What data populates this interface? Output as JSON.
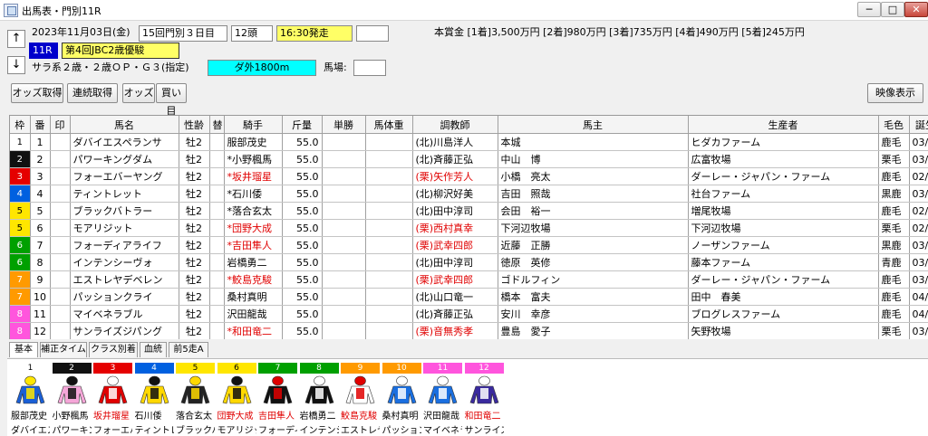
{
  "window": {
    "title": "出馬表・門別11R",
    "min": "─",
    "max": "□",
    "close": "✕"
  },
  "nav": {
    "up": "↑",
    "down": "↓"
  },
  "race": {
    "date": "2023年11月03日(金)",
    "meeting": "15回門別３日目",
    "heads": "12頭",
    "start": "16:30発走",
    "number": "11R",
    "name": "第4回JBC2歳優駿",
    "condition": "サラ系２歳・２歳ＯＰ・Ｇ３(指定)",
    "course": "ダ外1800m",
    "going_label": "馬場:",
    "prize": "本賞金 [1着]3,500万円 [2着]980万円 [3着]735万円 [4着]490万円 [5着]245万円"
  },
  "toolbar": {
    "odds_fetch": "オッズ取得",
    "auto_fetch": "連続取得",
    "odds": "オッズ",
    "buy": "買い目",
    "video": "映像表示"
  },
  "colors": {
    "waku": [
      "#ffffff",
      "#111111",
      "#e50000",
      "#0060e0",
      "#ffe600",
      "#ffe600",
      "#00a000",
      "#00a000",
      "#ff9a00",
      "#ff9a00",
      "#ff55dd",
      "#ff55dd"
    ],
    "waku_text": [
      "#000",
      "#fff",
      "#fff",
      "#fff",
      "#000",
      "#000",
      "#fff",
      "#fff",
      "#fff",
      "#fff",
      "#fff",
      "#fff"
    ],
    "start_bg": "#ffff66",
    "course_bg": "#00ffff",
    "race_no_bg": "#0000cc"
  },
  "table": {
    "headers": [
      "枠",
      "番",
      "印",
      "馬名",
      "性齢",
      "替",
      "騎手",
      "斤量",
      "単勝",
      "馬体重",
      "調教師",
      "馬主",
      "生産者",
      "毛色",
      "誕生"
    ],
    "rows": [
      {
        "waku": "1",
        "ban": "1",
        "mark": "",
        "name": "ダバイエスペランサ",
        "sex": "牡2",
        "change": "",
        "jockey": "服部茂史",
        "kin": "55.0",
        "tan": "",
        "weight": "",
        "trainer": "(北)川島洋人",
        "owner": "本城",
        "breeder": "ヒダカファーム",
        "color": "鹿毛",
        "birth": "03/22",
        "red": false
      },
      {
        "waku": "2",
        "ban": "2",
        "mark": "",
        "name": "パワーキングダム",
        "sex": "牡2",
        "change": "",
        "jockey": "*小野楓馬",
        "kin": "55.0",
        "tan": "",
        "weight": "",
        "trainer": "(北)斉藤正弘",
        "owner": "中山　博",
        "breeder": "広富牧場",
        "color": "栗毛",
        "birth": "03/05",
        "red": false
      },
      {
        "waku": "3",
        "ban": "3",
        "mark": "",
        "name": "フォーエバーヤング",
        "sex": "牡2",
        "change": "",
        "jockey": "*坂井瑠星",
        "kin": "55.0",
        "tan": "",
        "weight": "",
        "trainer": "(栗)矢作芳人",
        "owner": "小橋　亮太",
        "breeder": "ダーレー・ジャパン・ファーム",
        "color": "鹿毛",
        "birth": "02/15",
        "red": true
      },
      {
        "waku": "4",
        "ban": "4",
        "mark": "",
        "name": "ティントレット",
        "sex": "牡2",
        "change": "",
        "jockey": "*石川倭",
        "kin": "55.0",
        "tan": "",
        "weight": "",
        "trainer": "(北)柳沢好美",
        "owner": "吉田　照哉",
        "breeder": "社台ファーム",
        "color": "黒鹿",
        "birth": "03/28",
        "red": false
      },
      {
        "waku": "5",
        "ban": "5",
        "mark": "",
        "name": "ブラックバトラー",
        "sex": "牡2",
        "change": "",
        "jockey": "*落合玄太",
        "kin": "55.0",
        "tan": "",
        "weight": "",
        "trainer": "(北)田中淳司",
        "owner": "会田　裕一",
        "breeder": "増尾牧場",
        "color": "鹿毛",
        "birth": "02/25",
        "red": false
      },
      {
        "waku": "5",
        "ban": "6",
        "mark": "",
        "name": "モアリジット",
        "sex": "牡2",
        "change": "",
        "jockey": "*団野大成",
        "kin": "55.0",
        "tan": "",
        "weight": "",
        "trainer": "(栗)西村真幸",
        "owner": "下河辺牧場",
        "breeder": "下河辺牧場",
        "color": "栗毛",
        "birth": "02/10",
        "red": true
      },
      {
        "waku": "6",
        "ban": "7",
        "mark": "",
        "name": "フォーディアライフ",
        "sex": "牡2",
        "change": "",
        "jockey": "*吉田隼人",
        "kin": "55.0",
        "tan": "",
        "weight": "",
        "trainer": "(栗)武幸四郎",
        "owner": "近藤　正勝",
        "breeder": "ノーザンファーム",
        "color": "黒鹿",
        "birth": "03/01",
        "red": true
      },
      {
        "waku": "6",
        "ban": "8",
        "mark": "",
        "name": "インテンシーヴォ",
        "sex": "牡2",
        "change": "",
        "jockey": "岩橋勇二",
        "kin": "55.0",
        "tan": "",
        "weight": "",
        "trainer": "(北)田中淳司",
        "owner": "徳原　英修",
        "breeder": "藤本ファーム",
        "color": "青鹿",
        "birth": "03/20",
        "red": false
      },
      {
        "waku": "7",
        "ban": "9",
        "mark": "",
        "name": "エストレヤデベレン",
        "sex": "牡2",
        "change": "",
        "jockey": "*鮫島克駿",
        "kin": "55.0",
        "tan": "",
        "weight": "",
        "trainer": "(栗)武幸四郎",
        "owner": "ゴドルフィン",
        "breeder": "ダーレー・ジャパン・ファーム",
        "color": "鹿毛",
        "birth": "03/19",
        "red": true
      },
      {
        "waku": "7",
        "ban": "10",
        "mark": "",
        "name": "パッションクライ",
        "sex": "牡2",
        "change": "",
        "jockey": "桑村真明",
        "kin": "55.0",
        "tan": "",
        "weight": "",
        "trainer": "(北)山口竜一",
        "owner": "橋本　富夫",
        "breeder": "田中　春美",
        "color": "鹿毛",
        "birth": "04/30",
        "red": false
      },
      {
        "waku": "8",
        "ban": "11",
        "mark": "",
        "name": "マイベネラブル",
        "sex": "牡2",
        "change": "",
        "jockey": "沢田龍哉",
        "kin": "55.0",
        "tan": "",
        "weight": "",
        "trainer": "(北)斉藤正弘",
        "owner": "安川　幸彦",
        "breeder": "ブログレスファーム",
        "color": "鹿毛",
        "birth": "04/08",
        "red": false
      },
      {
        "waku": "8",
        "ban": "12",
        "mark": "",
        "name": "サンライズジパング",
        "sex": "牡2",
        "change": "",
        "jockey": "*和田竜二",
        "kin": "55.0",
        "tan": "",
        "weight": "",
        "trainer": "(栗)音無秀孝",
        "owner": "豊島　愛子",
        "breeder": "矢野牧場",
        "color": "栗毛",
        "birth": "03/13",
        "red": true
      }
    ]
  },
  "tabs": [
    "基本",
    "補正タイム",
    "クラス別着",
    "血統",
    "前5走A"
  ],
  "silks": [
    {
      "num": "1",
      "jockey": "服部茂史",
      "horse": "ダバイエスペ",
      "red": false,
      "body": "#1a5fd6",
      "pat": "#ffe600"
    },
    {
      "num": "2",
      "jockey": "小野楓馬",
      "horse": "パワーキング",
      "red": false,
      "body": "#f5a6d8",
      "pat": "#111111"
    },
    {
      "num": "3",
      "jockey": "坂井瑠星",
      "horse": "フォーエバー",
      "red": true,
      "body": "#e00000",
      "pat": "#ffffff"
    },
    {
      "num": "4",
      "jockey": "石川倭",
      "horse": "ティントレッ",
      "red": false,
      "body": "#ffd800",
      "pat": "#111111"
    },
    {
      "num": "5",
      "jockey": "落合玄太",
      "horse": "ブラックバト",
      "red": false,
      "body": "#222222",
      "pat": "#ffd800"
    },
    {
      "num": "6",
      "jockey": "団野大成",
      "horse": "モアリジット",
      "red": true,
      "body": "#ffd800",
      "pat": "#111111"
    },
    {
      "num": "7",
      "jockey": "吉田隼人",
      "horse": "フォーディア",
      "red": true,
      "body": "#111111",
      "pat": "#e00000"
    },
    {
      "num": "8",
      "jockey": "岩橋勇二",
      "horse": "インテンシー",
      "red": false,
      "body": "#111111",
      "pat": "#ffffff"
    },
    {
      "num": "9",
      "jockey": "鮫島克駿",
      "horse": "エストレヤデ",
      "red": true,
      "body": "#ffffff",
      "pat": "#e00000"
    },
    {
      "num": "10",
      "jockey": "桑村真明",
      "horse": "パッションク",
      "red": false,
      "body": "#1a6fe0",
      "pat": "#ffffff"
    },
    {
      "num": "11",
      "jockey": "沢田龍哉",
      "horse": "マイベネラブ",
      "red": false,
      "body": "#1a6fe0",
      "pat": "#ffffff"
    },
    {
      "num": "12",
      "jockey": "和田竜二",
      "horse": "サンライズジ",
      "red": true,
      "body": "#3a2a9e",
      "pat": "#ffffff"
    }
  ]
}
